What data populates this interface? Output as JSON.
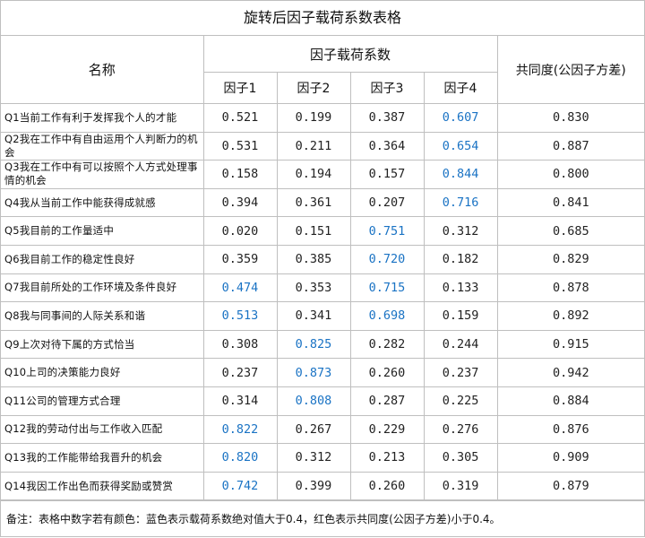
{
  "title": "旋转后因子载荷系数表格",
  "header": {
    "name": "名称",
    "group": "因子载荷系数",
    "factors": [
      "因子1",
      "因子2",
      "因子3",
      "因子4"
    ],
    "common": "共同度(公因子方差)"
  },
  "rows": [
    {
      "name": "Q1当前工作有利于发挥我个人的才能",
      "f1": "0.521",
      "f2": "0.199",
      "f3": "0.387",
      "f4": "0.607",
      "c": "0.830"
    },
    {
      "name": "Q2我在工作中有自由运用个人判断力的机会",
      "f1": "0.531",
      "f2": "0.211",
      "f3": "0.364",
      "f4": "0.654",
      "c": "0.887"
    },
    {
      "name": "Q3我在工作中有可以按照个人方式处理事情的机会",
      "f1": "0.158",
      "f2": "0.194",
      "f3": "0.157",
      "f4": "0.844",
      "c": "0.800"
    },
    {
      "name": "Q4我从当前工作中能获得成就感",
      "f1": "0.394",
      "f2": "0.361",
      "f3": "0.207",
      "f4": "0.716",
      "c": "0.841"
    },
    {
      "name": "Q5我目前的工作量适中",
      "f1": "0.020",
      "f2": "0.151",
      "f3": "0.751",
      "f4": "0.312",
      "c": "0.685"
    },
    {
      "name": "Q6我目前工作的稳定性良好",
      "f1": "0.359",
      "f2": "0.385",
      "f3": "0.720",
      "f4": "0.182",
      "c": "0.829"
    },
    {
      "name": "Q7我目前所处的工作环境及条件良好",
      "f1": "0.474",
      "f2": "0.353",
      "f3": "0.715",
      "f4": "0.133",
      "c": "0.878"
    },
    {
      "name": "Q8我与同事间的人际关系和谐",
      "f1": "0.513",
      "f2": "0.341",
      "f3": "0.698",
      "f4": "0.159",
      "c": "0.892"
    },
    {
      "name": "Q9上次对待下属的方式恰当",
      "f1": "0.308",
      "f2": "0.825",
      "f3": "0.282",
      "f4": "0.244",
      "c": "0.915"
    },
    {
      "name": "Q10上司的决策能力良好",
      "f1": "0.237",
      "f2": "0.873",
      "f3": "0.260",
      "f4": "0.237",
      "c": "0.942"
    },
    {
      "name": "Q11公司的管理方式合理",
      "f1": "0.314",
      "f2": "0.808",
      "f3": "0.287",
      "f4": "0.225",
      "c": "0.884"
    },
    {
      "name": "Q12我的劳动付出与工作收入匹配",
      "f1": "0.822",
      "f2": "0.267",
      "f3": "0.229",
      "f4": "0.276",
      "c": "0.876"
    },
    {
      "name": "Q13我的工作能带给我晋升的机会",
      "f1": "0.820",
      "f2": "0.312",
      "f3": "0.213",
      "f4": "0.305",
      "c": "0.909"
    },
    {
      "name": "Q14我因工作出色而获得奖励或赞赏",
      "f1": "0.742",
      "f2": "0.399",
      "f3": "0.260",
      "f4": "0.319",
      "c": "0.879"
    }
  ],
  "highlight": {
    "blue_color": "#1a73c4",
    "cells": {
      "f1": [
        6,
        7,
        11,
        12,
        13
      ],
      "f2": [
        8,
        9,
        10
      ],
      "f3": [
        4,
        5,
        6,
        7
      ],
      "f4": [
        0,
        1,
        2,
        3
      ]
    }
  },
  "note": "备注：表格中数字若有颜色：蓝色表示载荷系数绝对值大于0.4，红色表示共同度(公因子方差)小于0.4。"
}
